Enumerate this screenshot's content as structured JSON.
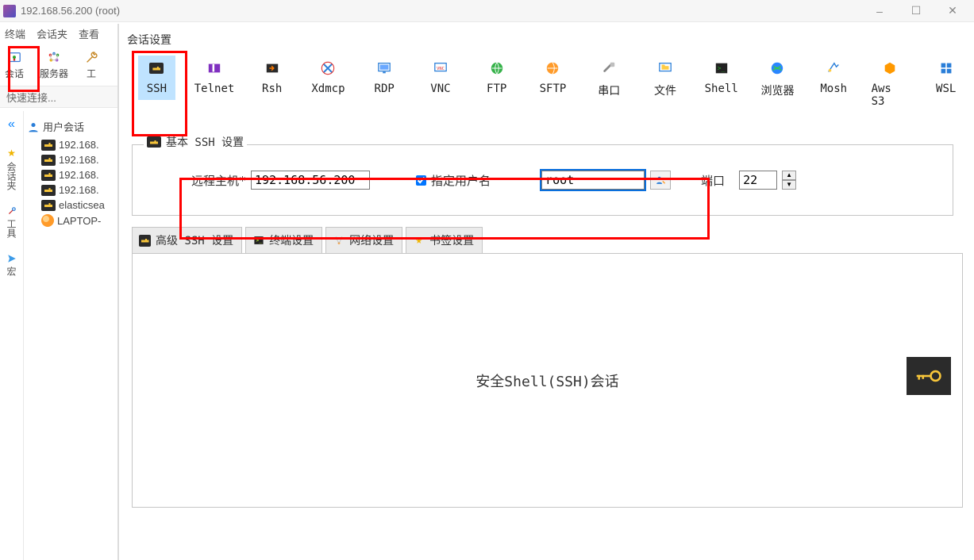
{
  "window": {
    "title": "192.168.56.200 (root)",
    "minimize": "–",
    "maximize": "☐",
    "close": "✕"
  },
  "menus": {
    "m1": "终端",
    "m2": "会话夹",
    "m3": "查看"
  },
  "toolbar": {
    "session": "会话",
    "server": "服务器",
    "tools": "工"
  },
  "quick": {
    "placeholder": "快速连接..."
  },
  "leftrail": {
    "tab1": "会话夹",
    "tab2": "工具",
    "tab3": "宏"
  },
  "tree": {
    "root": "用户会话",
    "items": [
      "192.168.",
      "192.168.",
      "192.168.",
      "192.168.",
      "elasticsea",
      "LAPTOP-"
    ]
  },
  "dialog": {
    "title": "会话设置",
    "protocols": [
      "SSH",
      "Telnet",
      "Rsh",
      "Xdmcp",
      "RDP",
      "VNC",
      "FTP",
      "SFTP",
      "串口",
      "文件",
      "Shell",
      "浏览器",
      "Mosh",
      "Aws S3",
      "WSL"
    ],
    "basic_group_title": "基本 SSH 设置",
    "remote_host_label": "远程主机*",
    "remote_host_value": "192.168.56.200",
    "specify_user_label": "指定用户名",
    "username_value": "root",
    "port_label": "端口",
    "port_value": "22",
    "tabs": {
      "adv": "高级 SSH 设置",
      "term": "终端设置",
      "net": "网络设置",
      "bm": "书签设置"
    },
    "panel_caption": "安全Shell(SSH)会话"
  }
}
